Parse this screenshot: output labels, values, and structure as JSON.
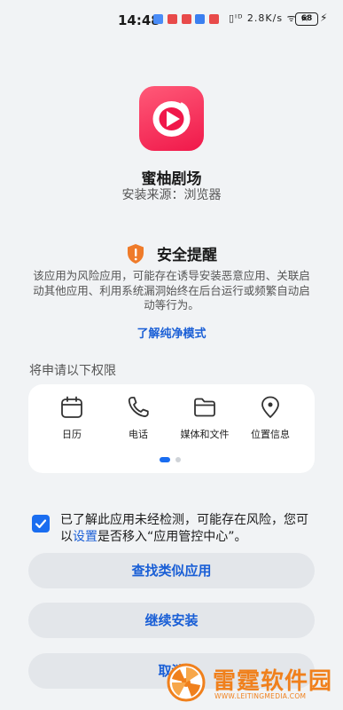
{
  "status_bar": {
    "time": "14:48",
    "system_icons": "▯ᴵᴰ 2.8K/s ᯤ ×",
    "network_speed": "2.8 K/s",
    "battery": "68"
  },
  "app": {
    "name": "蜜柚剧场",
    "source_label": "安装来源：",
    "source_value": "浏览器",
    "icon_color": "#f0184a"
  },
  "warning": {
    "title": "安全提醒",
    "text": "该应用为风险应用，可能存在诱导安装恶意应用、关联启动其他应用、利用系统漏洞始终在后台运行或频繁自动启动等行为。",
    "link": "了解纯净模式",
    "icon_color": "#ef7b2a"
  },
  "permissions": {
    "title": "将申请以下权限",
    "items": [
      {
        "label": "日历",
        "icon": "calendar-icon"
      },
      {
        "label": "电话",
        "icon": "phone-icon"
      },
      {
        "label": "媒体和文件",
        "icon": "folder-icon"
      },
      {
        "label": "位置信息",
        "icon": "location-icon"
      }
    ],
    "page": 1,
    "page_count": 2
  },
  "consent": {
    "checked": true,
    "text_before": "已了解此应用未经检测，可能存在风险，您可以",
    "link": "设置",
    "text_after": "是否移入“应用管控中心”。"
  },
  "buttons": {
    "find_similar": "查找类似应用",
    "continue": "继续安装",
    "cancel": "取消"
  },
  "watermark": {
    "text": "雷霆软件园",
    "url": "WWW.LEITINGMEDIA.COM"
  },
  "accent": "#1a6df0"
}
